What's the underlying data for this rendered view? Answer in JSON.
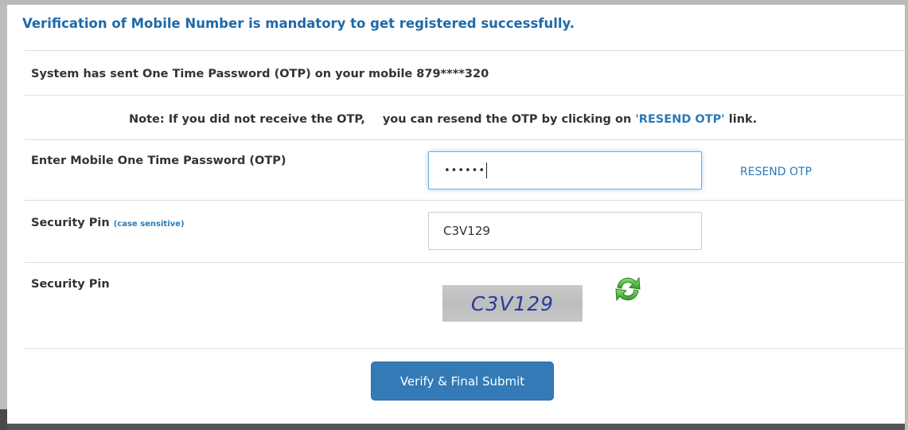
{
  "header": {
    "message": "Verification of Mobile Number is mandatory to get registered successfully."
  },
  "otp_sent": {
    "text": "System has sent One Time Password (OTP) on your mobile 879****320"
  },
  "note": {
    "prefix": "Note: If you did not receive the OTP,",
    "middle": "you can resend the OTP by clicking on",
    "link_text": "'RESEND OTP'",
    "suffix": "link."
  },
  "otp_field": {
    "label": "Enter Mobile One Time Password (OTP)",
    "masked_value": "••••••",
    "resend_label": "RESEND OTP"
  },
  "security_pin_input": {
    "label": "Security Pin",
    "hint": "(case sensitive)",
    "value": "C3V129"
  },
  "security_pin_captcha": {
    "label": "Security Pin",
    "captcha_text": "C3V129",
    "refresh_icon": "refresh-icon"
  },
  "submit": {
    "label": "Verify & Final Submit"
  },
  "colors": {
    "accent": "#337ab7",
    "link": "#2a7ab8",
    "header": "#1f6aa8"
  }
}
